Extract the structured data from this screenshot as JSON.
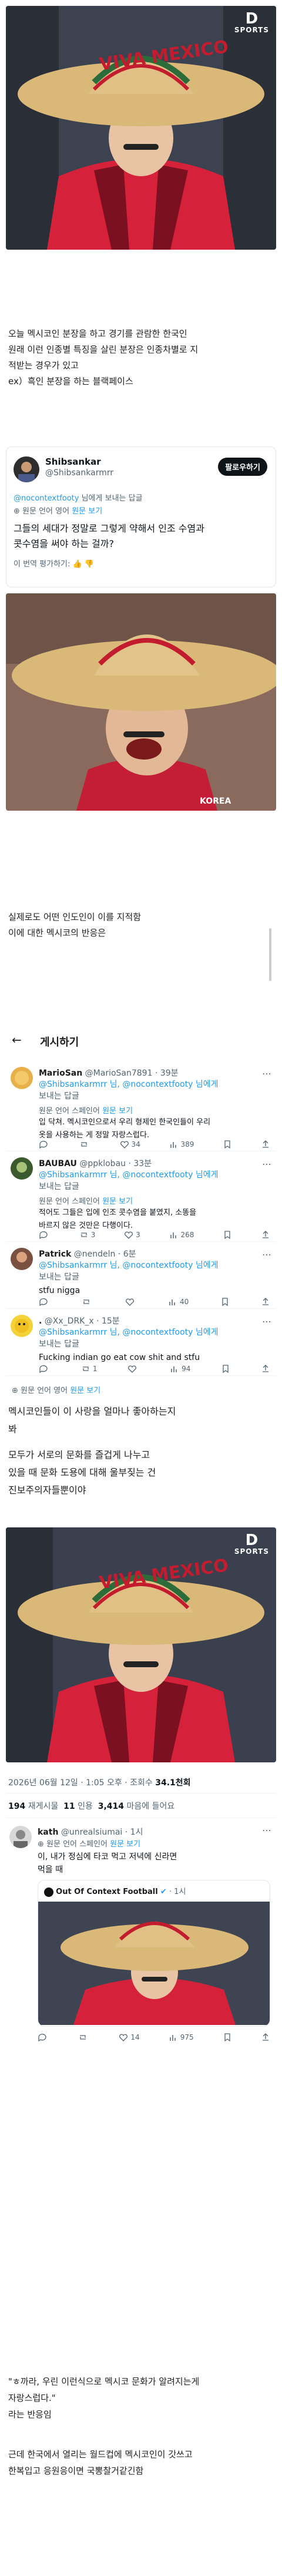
{
  "sports_logo": {
    "glyph": "D",
    "text": "SPORTS"
  },
  "intro_lines": [
    "오늘 멕시코인 분장을 하고 경기를 관람한 한국인",
    "원래 이런 인종별 특징을 살린 분장은 인종차별로 지",
    "적받는 경우가 있고",
    "ex）흑인 분장을 하는 블랙페이스"
  ],
  "tweet1": {
    "name": "Shibsankar",
    "handle": "@Shibsankarmrr",
    "follow": "팔로우하기",
    "reply_to_handle": "@nocontextfooty",
    "reply_to_suffix": " 님에게 보내는 답글",
    "lang_note": "원문 언어 영어",
    "lang_link": "원문 보기",
    "text_lines": [
      "그들의 세대가 정말로 그렇게 약해서 인조 수염과",
      "콧수염을 써야 하는 걸까?"
    ],
    "rate": "이 번역 평가하기:"
  },
  "middle_lines": [
    "실제로도 어떤 인도인이 이를 지적함",
    "이에 대한 멕시코의 반응은"
  ],
  "feed": {
    "back": "←",
    "title": "게시하기",
    "replies": [
      {
        "name": "MarioSan",
        "meta": "@MarioSan7891 · 39분",
        "rep1": "@Shibsankarmrr 님, @nocontextfooty 님에게",
        "rep2": "보내는 답글",
        "lang": "원문 언어 스페인어",
        "lang_link": "원문 보기",
        "text": [
          "입 닥쳐. 멕시코인으로서 우리 형제인 한국인들이 우리",
          "옷을 사용하는 게 정말 자랑스럽다."
        ],
        "stats": [
          "",
          "",
          "34",
          "389"
        ]
      },
      {
        "name": "BAUBAU",
        "meta": "@ppklobau · 33분",
        "rep1": "@Shibsankarmrr 님, @nocontextfooty 님에게",
        "rep2": "보내는 답글",
        "lang": "원문 언어 스페인어",
        "lang_link": "원문 보기",
        "text": [
          "적어도 그들은 입에 인조 콧수염을 붙였지, 소똥을",
          "바르지 않은 것만은 다행이다."
        ],
        "stats": [
          "",
          "3",
          "3",
          "268"
        ]
      },
      {
        "name": "Patrick",
        "meta": "@nendeln · 6분",
        "rep1": "@Shibsankarmrr 님, @nocontextfooty 님에게",
        "rep2": "보내는 답글",
        "lang": "",
        "lang_link": "",
        "text": [
          "stfu nigga"
        ],
        "stats": [
          "",
          "",
          "",
          "40"
        ]
      },
      {
        "name": ".",
        "meta": "@Xx_DRK_x · 15분",
        "rep1": "@Shibsankarmrr 님, @nocontextfooty 님에게",
        "rep2": "보내는 답글",
        "lang": "",
        "lang_link": "",
        "text": [
          "Fucking indian go eat cow shit and stfu"
        ],
        "stats": [
          "",
          "1",
          "",
          "94"
        ]
      }
    ],
    "footer_lang": "원문 언어 영어",
    "footer_link": "원문 보기"
  },
  "reaction_lines": [
    "멕시코인들이 이 사랑을 얼마나 좋아하는지",
    "봐",
    "",
    "모두가 서로의 문화를 즐겁게 나누고",
    "있을 때 문화 도용에 대해 울부짖는 건",
    "진보주의자들뿐이야"
  ],
  "post_meta": {
    "datetime": "2026년 06월 12일 · 1:05 오후 · 조회수",
    "views": "34.1천회",
    "reposts_n": "194",
    "reposts_l": "재게시물",
    "quotes_n": "11",
    "quotes_l": "인용",
    "likes_n": "3,414",
    "likes_l": "마음에 들어요"
  },
  "kath": {
    "name": "kath",
    "handle": "@unrealsiumai · 1시",
    "lang": "원문 언어 스페인어",
    "lang_link": "원문 보기",
    "text": [
      "이, 내가 정심에 타코 먹고 저녁에 신라면",
      "먹을 때"
    ],
    "quoted_name": "Out Of Context Football",
    "quoted_meta": "· 1시",
    "stats": [
      "",
      "",
      "14",
      "975"
    ]
  },
  "closing_lines": [
    "\"ㅎ까라, 우린 이런식으로 멕시코 문화가 알려지는게",
    "자랑스럽다.\"",
    "라는 반응임",
    "",
    "근데 한국에서 열리는 월드컵에 멕시코인이 갓쓰고",
    "한복입고 응원응이면 국뽕찰거같긴함"
  ],
  "colors": {
    "red": "#d6213a",
    "sombrero": "#d9b878",
    "link": "#1d9bf0"
  }
}
